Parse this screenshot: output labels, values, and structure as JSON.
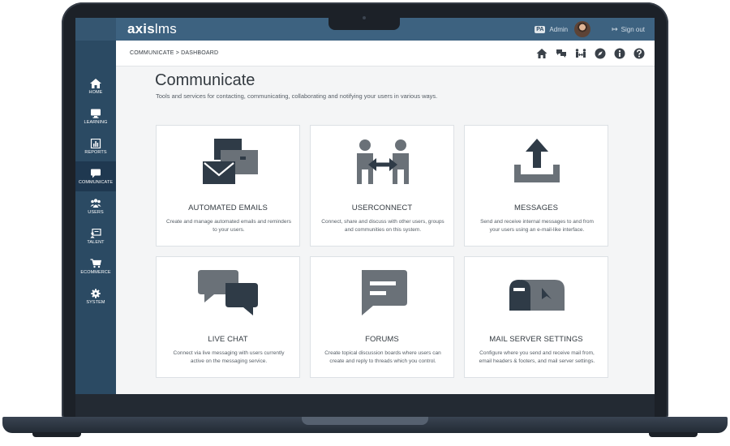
{
  "app": {
    "brand_bold": "axis",
    "brand_light": "lms"
  },
  "user": {
    "badge": "PA",
    "name": "Admin",
    "signout": "Sign out"
  },
  "breadcrumb": "COMMUNICATE > DASHBOARD",
  "toolbar": {
    "icons": [
      "home-icon",
      "chat-icon",
      "userconnect-icon",
      "compass-icon",
      "info-icon",
      "help-icon"
    ]
  },
  "sidebar": {
    "items": [
      {
        "label": "HOME",
        "icon": "home-icon"
      },
      {
        "label": "LEARNING",
        "icon": "monitor-icon"
      },
      {
        "label": "REPORTS",
        "icon": "bar-chart-icon"
      },
      {
        "label": "COMMUNICATE",
        "icon": "chat-bubble-icon",
        "active": true
      },
      {
        "label": "USERS",
        "icon": "users-icon"
      },
      {
        "label": "TALENT",
        "icon": "presentation-icon"
      },
      {
        "label": "ECOMMERCE",
        "icon": "cart-icon"
      },
      {
        "label": "SYSTEM",
        "icon": "gear-icon"
      }
    ]
  },
  "page": {
    "title": "Communicate",
    "subtitle": "Tools and services for contacting, communicating, collaborating and notifying your users in various ways."
  },
  "cards": [
    {
      "title": "AUTOMATED EMAILS",
      "desc": "Create and manage automated emails and reminders to your users.",
      "icon": "automated-email-icon"
    },
    {
      "title": "USERCONNECT",
      "desc": "Connect, share and discuss with other users, groups and communities on this system.",
      "icon": "userconnect-icon"
    },
    {
      "title": "MESSAGES",
      "desc": "Send and receive internal messages to and from your users using an e-mail-like interface.",
      "icon": "upload-tray-icon"
    },
    {
      "title": "LIVE CHAT",
      "desc": "Connect via live messaging with users currently active on the messaging service.",
      "icon": "chat-bubbles-icon"
    },
    {
      "title": "FORUMS",
      "desc": "Create topical discussion boards where users can create and reply to threads which you control.",
      "icon": "forum-bubble-icon"
    },
    {
      "title": "MAIL SERVER SETTINGS",
      "desc": "Configure where you send and receive mail from, email headers & footers, and mail server settings.",
      "icon": "mailbox-icon"
    }
  ],
  "colors": {
    "topbar": "#3d6280",
    "sidebar": "#2b4a63",
    "sidebar_active": "#1f3850",
    "icon_dark": "#2f3b47",
    "icon_mid": "#6a7178",
    "frame": "#1c2128"
  }
}
